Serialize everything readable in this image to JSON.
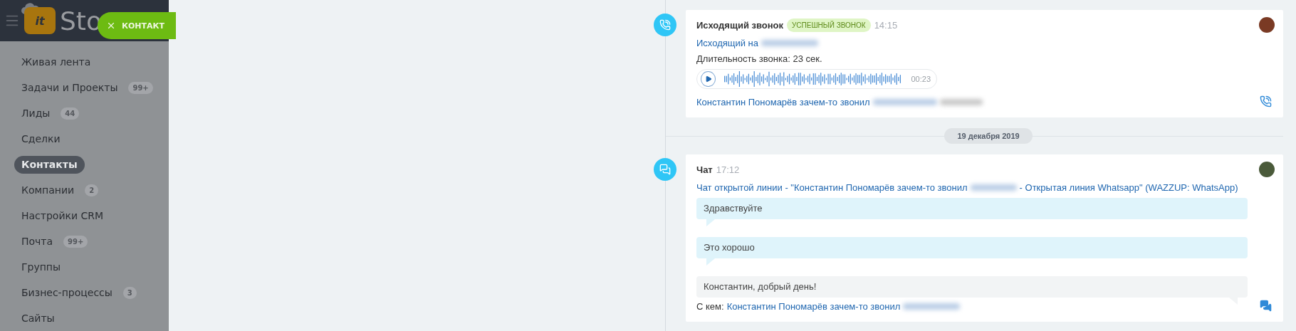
{
  "header": {
    "logo_mark": "it",
    "logo_text": "Sto",
    "close_button": {
      "label": "КОНТАКТ"
    }
  },
  "sidebar": {
    "items": [
      {
        "label": "Живая лента",
        "selected": false
      },
      {
        "label": "Задачи и Проекты",
        "counter": "99+",
        "selected": false
      },
      {
        "label": "Лиды",
        "counter": "44",
        "selected": false
      },
      {
        "label": "Сделки",
        "selected": false
      },
      {
        "label": "Контакты",
        "selected": true
      },
      {
        "label": "Компании",
        "counter": "2",
        "selected": false
      },
      {
        "label": "Настройки CRM",
        "selected": false
      },
      {
        "label": "Почта",
        "counter": "99+",
        "selected": false
      },
      {
        "label": "Группы",
        "selected": false
      },
      {
        "label": "Бизнес-процессы",
        "counter": "3",
        "selected": false
      },
      {
        "label": "Сайты",
        "selected": false
      }
    ]
  },
  "timeline": [
    {
      "kind": "call",
      "title": "Исходящий звонок",
      "badge": "УСПЕШНЫЙ ЗВОНОК",
      "time": "14:15",
      "direction_label": "Исходящий на",
      "duration": "Длительность звонка: 23 сек.",
      "audio": {
        "duration": "00:23"
      },
      "contact": "Константин Пономарёв зачем-то звонил"
    },
    {
      "kind": "date",
      "label": "19 декабря 2019"
    },
    {
      "kind": "chat",
      "title": "Чат",
      "time": "17:12",
      "line_prefix": "Чат открытой линии - \"Константин Пономарёв зачем-то звонил",
      "line_suffix": "- Открытая линия Whatsapp\" (WAZZUP: WhatsApp)",
      "messages": [
        {
          "kind": "incoming",
          "text": "Здравствуйте"
        },
        {
          "kind": "incoming",
          "text": "Это хорошо"
        },
        {
          "kind": "outgoing",
          "text": "Константин, добрый день!"
        }
      ],
      "with_label": "С кем:",
      "contact": "Константин Пономарёв зачем-то звонил"
    }
  ]
}
